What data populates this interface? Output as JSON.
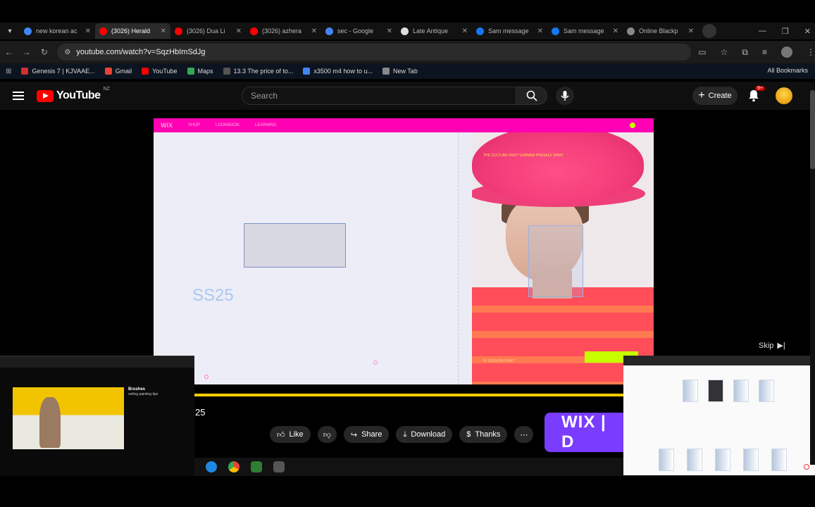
{
  "browser": {
    "tabs": [
      {
        "label": "new korean ac",
        "color": "#4285f4",
        "active": false
      },
      {
        "label": "(3026) Herald",
        "color": "#ff0000",
        "active": true
      },
      {
        "label": "(3026) Dua Li",
        "color": "#ff0000",
        "active": false
      },
      {
        "label": "(3026) azhera",
        "color": "#ff0000",
        "active": false
      },
      {
        "label": "sec - Google",
        "color": "#4285f4",
        "active": false
      },
      {
        "label": "Late Antique",
        "color": "#dddddd",
        "active": false
      },
      {
        "label": "Sam message",
        "color": "#1877f2",
        "active": false
      },
      {
        "label": "Sam message",
        "color": "#1877f2",
        "active": false
      },
      {
        "label": "Online Blackp",
        "color": "#888888",
        "active": false
      }
    ],
    "url": "youtube.com/watch?v=SqzHbImSdJg",
    "bookmarks": [
      {
        "label": "Genesis 7 | KJVAAE...",
        "color": "#d32f2f"
      },
      {
        "label": "Gmail",
        "color": "#ea4335"
      },
      {
        "label": "YouTube",
        "color": "#ff0000"
      },
      {
        "label": "Maps",
        "color": "#34a853"
      },
      {
        "label": "13.3 The price of to...",
        "color": "#555555"
      },
      {
        "label": "x3500 m4 how to u...",
        "color": "#4285f4"
      },
      {
        "label": "New Tab",
        "color": "#888888"
      }
    ],
    "all_bookmarks_label": "All Bookmarks"
  },
  "youtube": {
    "logo_text": "YouTube",
    "country": "NZ",
    "search_placeholder": "Search",
    "create_label": "Create",
    "notifications_badge": "9+",
    "skip_label": "Skip",
    "video_title_fragment": "25",
    "progress_fraction": 1.0,
    "actions": {
      "like": "Like",
      "share": "Share",
      "download": "Download",
      "thanks": "Thanks"
    },
    "ad_banner_text": "WIX | D"
  },
  "video": {
    "nav_items": [
      "WIX",
      "SHOP",
      "LOOKBOOK",
      "LEARNING"
    ],
    "heading": "SS25",
    "hat_caption": "THE CULTURE KNOT SUMMER PRESALE SHIRT",
    "product_tag": "IN SESSION SHIRT",
    "accent_color": "#ff00b4",
    "lime_color": "#c6ff00"
  },
  "pip_left": {
    "title": "Brushes",
    "caption": "ceiling painting tips"
  }
}
